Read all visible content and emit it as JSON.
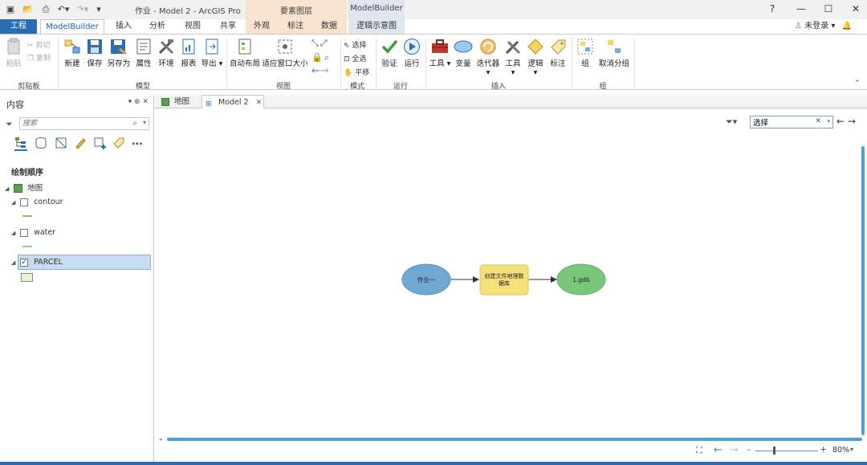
{
  "titlebar": {
    "title": "作业 - Model 2 - ArcGIS Pro",
    "context_groups": [
      "要素图层",
      "ModelBuilder"
    ],
    "window_buttons": [
      "?",
      "—",
      "☐",
      "✕"
    ],
    "login": "未登录"
  },
  "tabs": [
    {
      "label": "工程"
    },
    {
      "label": "ModelBuilder"
    },
    {
      "label": "插入"
    },
    {
      "label": "分析"
    },
    {
      "label": "视图"
    },
    {
      "label": "共享"
    },
    {
      "label": "外观"
    },
    {
      "label": "标注"
    },
    {
      "label": "数据"
    },
    {
      "label": "逻辑示意图"
    }
  ],
  "ribbon": {
    "clipboard": {
      "paste": "粘贴",
      "cut": "剪切",
      "copy": "复制",
      "label": "剪贴板"
    },
    "model": {
      "new": "新建",
      "save": "保存",
      "save_as": "另存为",
      "properties": "属性",
      "environments": "环境",
      "report": "报表",
      "export": "导出",
      "label": "模型"
    },
    "view": {
      "auto_layout": "自动布局",
      "fit_to_window": "适应窗口大小",
      "label": "视图"
    },
    "mode": {
      "select": "选择",
      "select_all": "全选",
      "pan": "平移",
      "label": "模式"
    },
    "run": {
      "validate": "验证",
      "run": "运行",
      "label": "运行"
    },
    "insert": {
      "tools": "工具",
      "variable": "变量",
      "iterators": "迭代器",
      "utilities": "工具",
      "logical": "逻辑",
      "label_btn": "标注",
      "label": "插入"
    },
    "group": {
      "group": "组",
      "ungroup": "取消分组",
      "label": "组"
    }
  },
  "contents": {
    "title": "内容",
    "search_placeholder": "搜索",
    "draw_order": "绘制顺序",
    "map": "地图",
    "layers": [
      {
        "name": "contour",
        "checked": false,
        "color": "#b8a27a"
      },
      {
        "name": "water",
        "checked": false,
        "color": "#8fd48f"
      },
      {
        "name": "PARCEL",
        "checked": true,
        "color": "#e6f7c8"
      }
    ]
  },
  "view_tabs": [
    {
      "label": "地图"
    },
    {
      "label": "Model 2"
    }
  ],
  "canvas": {
    "select_value": "选择",
    "nodes": [
      {
        "label": "作业一",
        "type": "ellipse",
        "fill": "#6ea8d3"
      },
      {
        "label": "创建文件地理数据库",
        "type": "rect",
        "fill": "#f5e07a"
      },
      {
        "label": "1.gdb",
        "type": "ellipse",
        "fill": "#79c77a"
      }
    ]
  },
  "status": {
    "zoom": "80%"
  }
}
